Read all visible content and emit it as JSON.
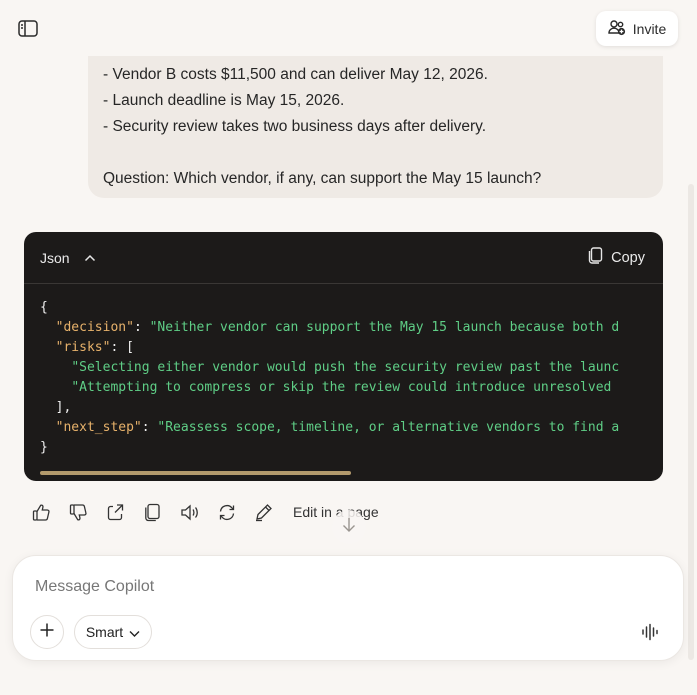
{
  "header": {
    "invite_label": "Invite",
    "sidebar_icon": "sidebar-toggle-icon",
    "invite_icon": "add-person-icon"
  },
  "user_message": {
    "lines": [
      "- Vendor B costs $11,500 and can deliver May 12, 2026.",
      "- Launch deadline is May 15, 2026.",
      "- Security review takes two business days after delivery."
    ],
    "question": "Question: Which vendor, if any, can support the May 15 launch?"
  },
  "code_block": {
    "language": "Json",
    "copy_label": "Copy",
    "brace_open": "{",
    "brace_close": "}",
    "decision_key": "\"decision\"",
    "decision_value": "\"Neither vendor can support the May 15 launch because both d",
    "risks_key": "\"risks\"",
    "risk_1": "\"Selecting either vendor would push the security review past the launc",
    "risk_2": "\"Attempting to compress or skip the review could introduce unresolved",
    "array_close": "],",
    "next_step_key": "\"next_step\"",
    "next_step_value": "\"Reassess scope, timeline, or alternative vendors to find a"
  },
  "actions": {
    "edit_label": "Edit in a page"
  },
  "composer": {
    "placeholder": "Message Copilot",
    "mode_label": "Smart"
  },
  "colors": {
    "background": "#f9f6f3",
    "bubble": "#efeae5",
    "code_bg": "#1c1a19",
    "json_key": "#e7b26b",
    "json_string": "#5fce86"
  }
}
